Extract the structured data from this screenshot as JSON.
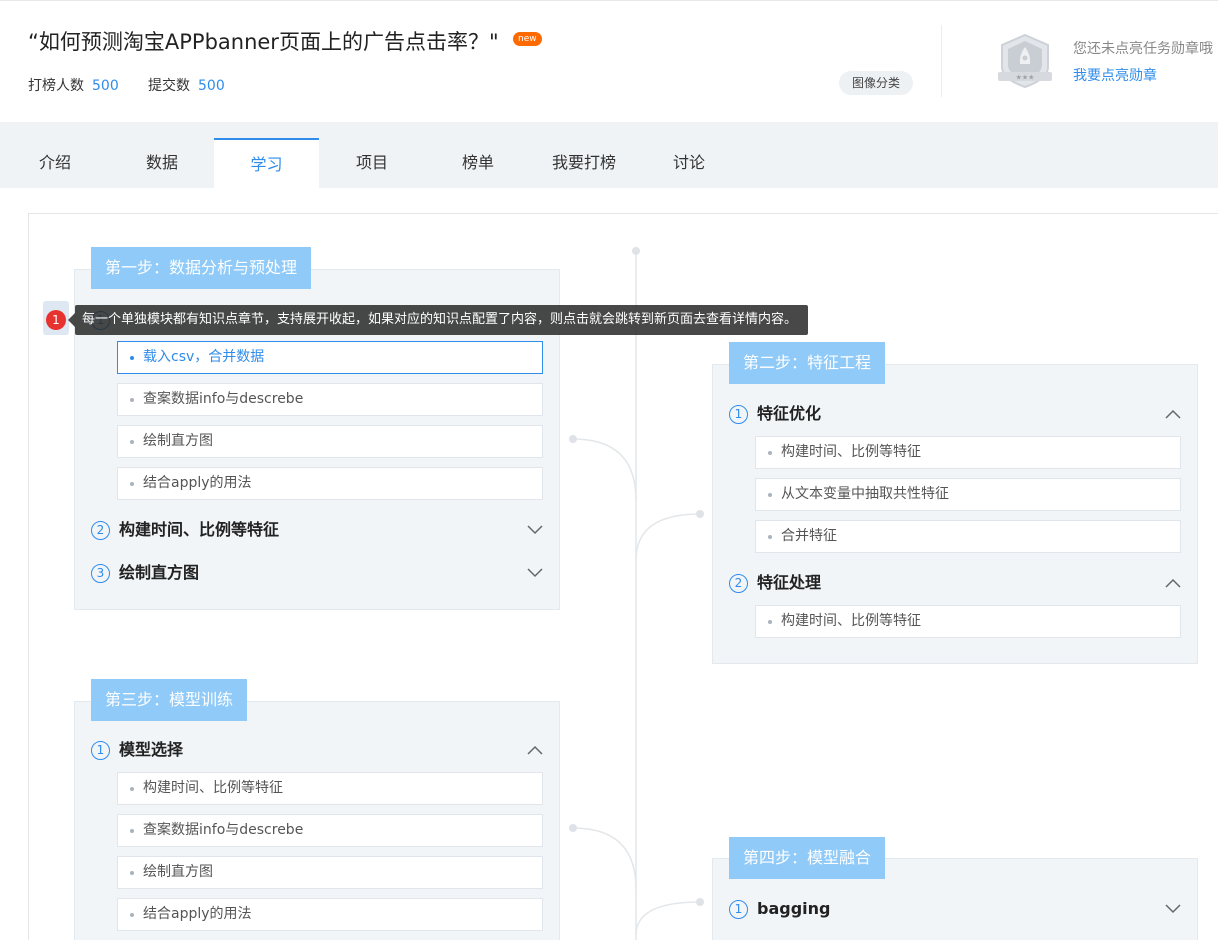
{
  "header": {
    "title": "“如何预测淘宝APPbanner页面上的广告点击率？\"",
    "new_badge": "new",
    "stats": [
      {
        "label": "打榜人数",
        "value": "500"
      },
      {
        "label": "提交数",
        "value": "500"
      }
    ],
    "category_tag": "图像分类",
    "medal_text": "您还未点亮任务勋章哦",
    "medal_link": "我要点亮勋章"
  },
  "tabs": [
    {
      "label": "介绍",
      "active": false
    },
    {
      "label": "数据",
      "active": false
    },
    {
      "label": "学习",
      "active": true
    },
    {
      "label": "项目",
      "active": false
    },
    {
      "label": "榜单",
      "active": false
    },
    {
      "label": "我要打榜",
      "active": false
    },
    {
      "label": "讨论",
      "active": false
    }
  ],
  "tooltip": {
    "number": "1",
    "text": "每一个单独模块都有知识点章节，支持展开收起，如果对应的知识点配置了内容，则点击就会跳转到新页面去查看详情内容。"
  },
  "steps": [
    {
      "label": "第一步：数据分析与预处理",
      "sections": [
        {
          "num": "1",
          "title": "",
          "expanded": true,
          "items": [
            {
              "label": "载入csv，合并数据",
              "active": true
            },
            {
              "label": "查案数据info与descrebe",
              "active": false
            },
            {
              "label": "绘制直方图",
              "active": false
            },
            {
              "label": "结合apply的用法",
              "active": false
            }
          ]
        },
        {
          "num": "2",
          "title": "构建时间、比例等特征",
          "expanded": false,
          "items": []
        },
        {
          "num": "3",
          "title": "绘制直方图",
          "expanded": false,
          "items": []
        }
      ]
    },
    {
      "label": "第二步：特征工程",
      "sections": [
        {
          "num": "1",
          "title": "特征优化",
          "expanded": true,
          "items": [
            {
              "label": "构建时间、比例等特征",
              "active": false
            },
            {
              "label": "从文本变量中抽取共性特征",
              "active": false
            },
            {
              "label": "合并特征",
              "active": false
            }
          ]
        },
        {
          "num": "2",
          "title": "特征处理",
          "expanded": true,
          "items": [
            {
              "label": "构建时间、比例等特征",
              "active": false
            }
          ]
        }
      ]
    },
    {
      "label": "第三步：模型训练",
      "sections": [
        {
          "num": "1",
          "title": "模型选择",
          "expanded": true,
          "items": [
            {
              "label": "构建时间、比例等特征",
              "active": false
            },
            {
              "label": "查案数据info与descrebe",
              "active": false
            },
            {
              "label": "绘制直方图",
              "active": false
            },
            {
              "label": "结合apply的用法",
              "active": false
            }
          ]
        }
      ]
    },
    {
      "label": "第四步：模型融合",
      "sections": [
        {
          "num": "1",
          "title": "bagging",
          "expanded": false,
          "items": []
        }
      ]
    }
  ]
}
